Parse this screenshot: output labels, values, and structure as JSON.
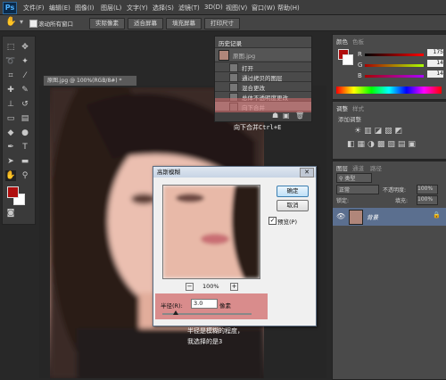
{
  "app": {
    "logo": "Ps"
  },
  "menu": [
    "文件(F)",
    "编辑(E)",
    "图像(I)",
    "图层(L)",
    "文字(Y)",
    "选择(S)",
    "滤镜(T)",
    "3D(D)",
    "视图(V)",
    "窗口(W)",
    "帮助(H)"
  ],
  "options_bar": {
    "scroll_all_label": "滚动所有窗口",
    "actual_pixels": "实际像素",
    "fit_screen": "适合屏幕",
    "fill_screen": "填充屏幕",
    "print_size": "打印尺寸"
  },
  "document": {
    "tab_title": "原图.jpg @ 100%(RGB/8#) *"
  },
  "history": {
    "title": "历史记录",
    "snapshot": "原图.jpg",
    "items": [
      "打开",
      "通过拷贝的图层",
      "混合更改",
      "总体不透明度更改",
      "向下合并"
    ],
    "highlight_index": 4
  },
  "color_panel": {
    "tabs": [
      "颜色",
      "色板"
    ],
    "channels": [
      {
        "label": "R",
        "value": "175"
      },
      {
        "label": "G",
        "value": "14"
      },
      {
        "label": "B",
        "value": "14"
      }
    ],
    "fg_color": "#af0e0e",
    "bg_color": "#ffffff"
  },
  "adjustments_panel": {
    "tabs": [
      "调整",
      "样式"
    ],
    "subtitle": "添加调整"
  },
  "layers_panel": {
    "tabs": [
      "图层",
      "通道",
      "路径"
    ],
    "filter_type": "类型",
    "blend_mode": "正常",
    "opacity_label": "不透明度:",
    "opacity_value": "100%",
    "lock_label": "锁定:",
    "fill_label": "填充:",
    "fill_value": "100%",
    "layer_name": "背景"
  },
  "dialog": {
    "title": "高斯模糊",
    "ok": "确定",
    "cancel": "取消",
    "preview_label": "预览(P)",
    "zoom_value": "100%",
    "zoom_minus": "−",
    "zoom_plus": "+",
    "radius_label": "半径(R):",
    "radius_value": "3.0",
    "radius_unit": "像素",
    "radius_slider_position": 0.15
  },
  "annotations": {
    "merge_down": "向下合并Ctrl+E",
    "radius_note_1": "半径是模糊的程度，",
    "radius_note_2": "我选择的是3"
  },
  "colors": {
    "highlight": "#d96c6c",
    "accent_blue": "#3e79c9"
  }
}
